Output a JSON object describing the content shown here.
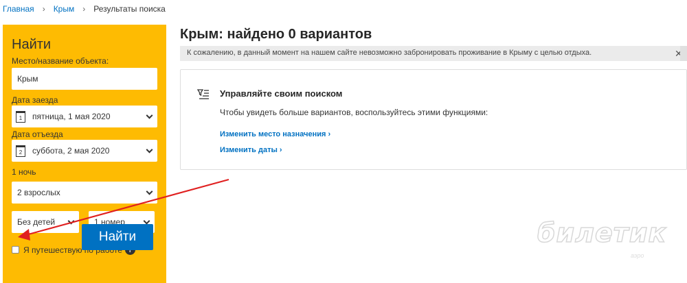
{
  "breadcrumb": {
    "home": "Главная",
    "region": "Крым",
    "current": "Результаты поиска"
  },
  "search": {
    "title": "Найти",
    "destination_label": "Место/название объекта:",
    "destination_value": "Крым",
    "checkin_label": "Дата заезда",
    "checkin_value": "пятница, 1 мая 2020",
    "checkin_icon_day": "1",
    "checkout_label": "Дата отъезда",
    "checkout_value": "суббота, 2 мая 2020",
    "checkout_icon_day": "2",
    "nights": "1 ночь",
    "adults": "2 взрослых",
    "children": "Без детей",
    "rooms": "1 номер",
    "business_trip_label": "Я путешествую по работе",
    "business_trip_checked": false,
    "help": "?",
    "submit": "Найти"
  },
  "results": {
    "title": "Крым: найдено 0 вариантов",
    "notice": "К сожалению, в данный момент на нашем сайте невозможно забронировать проживание в Крыму с целью отдыха.",
    "close": "✕",
    "card": {
      "title": "Управляйте своим поиском",
      "text": "Чтобы увидеть больше вариантов, воспользуйтесь этими функциями:",
      "link_destination": "Изменить место назначения ›",
      "link_dates": "Изменить даты ›"
    }
  },
  "watermark": {
    "text": "билетик",
    "sub": "аэро"
  },
  "colors": {
    "panel": "#febb02",
    "accent": "#0071c2",
    "arrow": "#e02020"
  },
  "icons": [
    "calendar-icon",
    "chevron-down-icon",
    "help-icon",
    "close-icon",
    "filter-list-icon"
  ]
}
